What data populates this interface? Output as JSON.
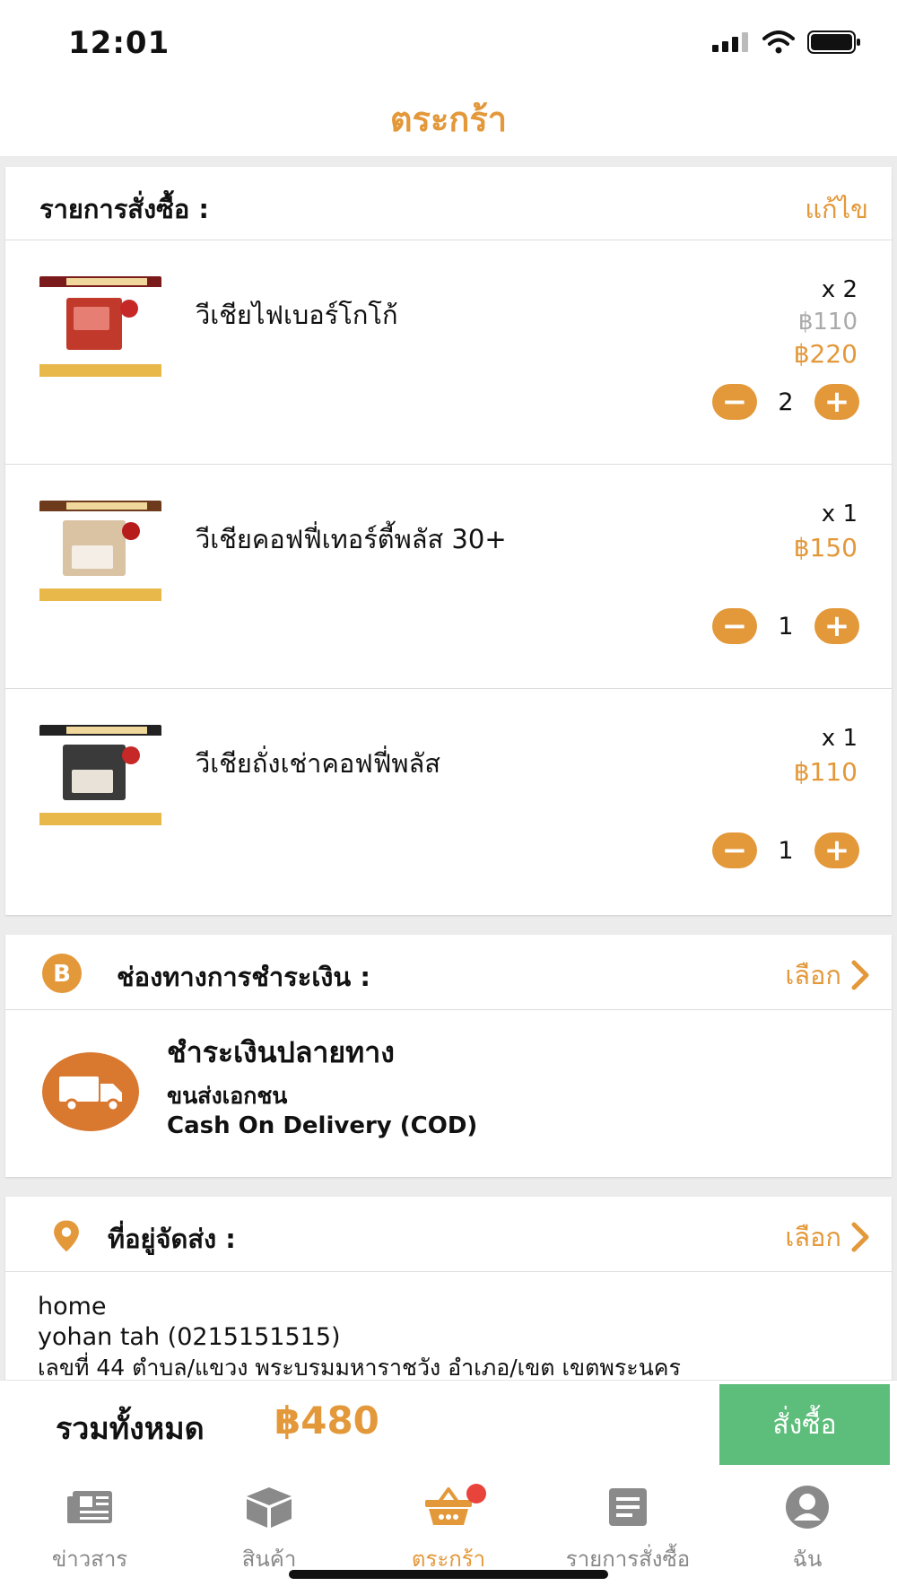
{
  "status": {
    "time": "12:01"
  },
  "header": {
    "title": "ตระกร้า"
  },
  "order": {
    "label": "รายการสั่งซื้อ :",
    "edit": "แก้ไข",
    "items": [
      {
        "name": "วีเชียไฟเบอร์โกโก้",
        "qty_label": "x 2",
        "unit_price": "฿110",
        "price": "฿220",
        "qty": "2"
      },
      {
        "name": "วีเชียคอฟฟี่เทอร์ตี้พลัส 30+",
        "qty_label": "x 1",
        "price": "฿150",
        "qty": "1"
      },
      {
        "name": "วีเชียถั่งเช่าคอฟฟี่พลัส",
        "qty_label": "x 1",
        "price": "฿110",
        "qty": "1"
      }
    ]
  },
  "payment": {
    "label": "ช่องทางการชำระเงิน :",
    "choose": "เลือก",
    "method_title": "ชำระเงินปลายทาง",
    "method_sub": "ขนส่งเอกชน",
    "method_en": "Cash On Delivery (COD)"
  },
  "address": {
    "label": "ที่อยู่จัดส่ง :",
    "choose": "เลือก",
    "line1": "home",
    "line2": "yohan tah (0215151515)",
    "line3": "เลขที่ 44  ตำบล/แขวง พระบรมมหาราชวัง อำเภอ/เขต เขตพระนคร"
  },
  "footer": {
    "total_label": "รวมทั้งหมด",
    "total": "฿480",
    "order_button": "สั่งซื้อ"
  },
  "tabs": [
    {
      "label": "ข่าวสาร",
      "icon": "news-icon"
    },
    {
      "label": "สินค้า",
      "icon": "box-icon"
    },
    {
      "label": "ตระกร้า",
      "icon": "basket-icon"
    },
    {
      "label": "รายการสั่งซื้อ",
      "icon": "list-icon"
    },
    {
      "label": "ฉัน",
      "icon": "user-icon"
    }
  ],
  "colors": {
    "accent": "#e3983a",
    "order_button": "#5dbd7a",
    "badge": "#e8443c"
  }
}
